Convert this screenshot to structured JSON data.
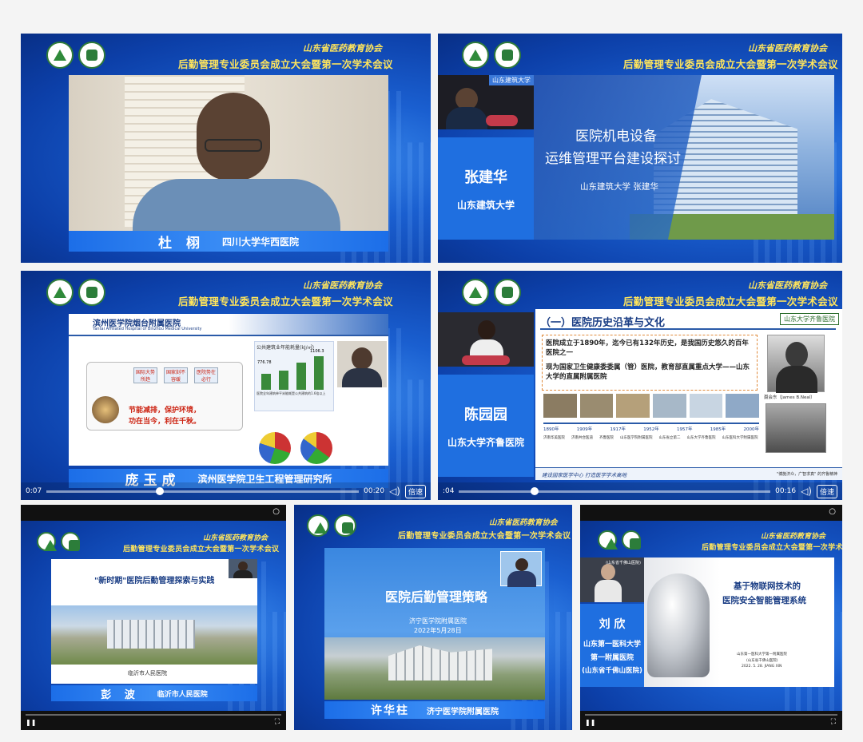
{
  "common": {
    "org_name": "山东省医药教育协会",
    "conference_title": "后勤管理专业委员会成立大会暨第一次学术会议"
  },
  "tiles": {
    "t1": {
      "speaker": "杜  栩",
      "affiliation": "四川大学华西医院"
    },
    "t2": {
      "speaker": "张建华",
      "affiliation": "山东建筑大学",
      "video_label": "山东建筑大学",
      "slide_title_1": "医院机电设备",
      "slide_title_2": "运维管理平台建设探讨",
      "slide_byline": "山东建筑大学  张建华"
    },
    "t3": {
      "speaker": "庞玉成",
      "affiliation": "滨州医学院卫生工程管理研究所",
      "slide_header": "滨州医学院烟台附属医院",
      "slide_header_en": "Yantai Affiliated Hospital of Binzhou Medical University",
      "chart_title": "公共建筑业年能耗量(kJ/㎡)",
      "bar_labels": [
        "776.78",
        "800.78",
        "1000.3",
        "1106.3"
      ],
      "box1": "国际大势所趋",
      "box2": "国家刻不容缓",
      "box3": "医院势在必行",
      "slogan_1": "节能减排，保护环境，",
      "slogan_2": "功在当今，利在千秋。",
      "table_caption": "医院全年建筑单平米能耗是公共建筑的1.6倍以上",
      "time_left": "0:07",
      "time_right": "00:20",
      "speed": "倍速",
      "progress": 0.35
    },
    "t4": {
      "speaker": "陈园园",
      "affiliation": "山东大学齐鲁医院",
      "slide_title": "（一）医院历史沿革与文化",
      "brand": "山东大学齐鲁医院",
      "point_1": "医院成立于1890年，迄今已有132年历史，是我国历史悠久的百年医院之一",
      "point_2": "现为国家卫生健康委委属（管）医院，教育部直属重点大学——山东大学的直属附属医院",
      "years": [
        "1890年",
        "1909年",
        "1917年",
        "1952年",
        "1957年",
        "1985年",
        "2000年"
      ],
      "year_names": [
        "济南华美医院",
        "济南共合医道",
        "齐鲁医院",
        "山东医学院附属医院",
        "山东省立第二",
        "山东大学齐鲁医院",
        "山东医科大学附属医院"
      ],
      "founder": "聂会东（James B.Neal）",
      "footer": "建设国家医学中心  打造医学学术高地",
      "motto": "\"博施济众，广智求真\" 的齐鲁精神",
      "time_left": ":04",
      "time_right": "00:16",
      "speed": "倍速",
      "progress": 0.23
    },
    "t5": {
      "speaker": "彭  波",
      "affiliation": "临沂市人民医院",
      "slide_title": "\"新时期\"医院后勤管理探索与实践",
      "slide_caption": "临沂市人民医院"
    },
    "t6": {
      "speaker": "许华柱",
      "affiliation": "济宁医学院附属医院",
      "slide_title": "医院后勤管理策略",
      "slide_sub_1": "济宁医学院附属医院",
      "slide_sub_2": "2022年5月28日"
    },
    "t7": {
      "speaker": "刘  欣",
      "aff_line1": "山东第一医科大学",
      "aff_line2": "第一附属医院",
      "aff_line3": "(山东省千佛山医院)",
      "slide_title_1": "基于物联网技术的",
      "slide_title_2": "医院安全智能管理系统",
      "slide_small_1": "山东第一医科大学第一附属医院",
      "slide_small_2": "(山东省千佛山医院)",
      "slide_small_3": "2022. 5. 28. JIANG XIN",
      "video_label": "(山东省千佛山医院)"
    }
  },
  "colors": {
    "accent_yellow": "#ffe55c",
    "bar_blue": "#1f6fe0"
  }
}
